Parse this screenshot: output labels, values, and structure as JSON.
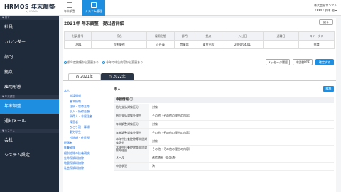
{
  "brand": {
    "name": "HRMOS 年末調整",
    "sub": "by IEYASU"
  },
  "sidebar": {
    "section_basic": "▼ 基本",
    "items_basic": [
      {
        "label": "社員"
      },
      {
        "label": "カレンダー"
      },
      {
        "label": "部門"
      },
      {
        "label": "拠点"
      },
      {
        "label": "雇用形態"
      }
    ],
    "section_year_end": "▼ 年末調整",
    "items_year_end": [
      {
        "label": "年末調整",
        "active": true
      },
      {
        "label": "通知メール"
      }
    ],
    "section_system": "▼ システム",
    "items_system": [
      {
        "label": "会社"
      },
      {
        "label": "システム設定"
      }
    ]
  },
  "topbar": {
    "tabs": [
      {
        "label": "年末調整"
      },
      {
        "label": "システム管理",
        "active": true
      }
    ],
    "company": "株式会社サンプル",
    "user": "XXXXX 鈴木 優 ▾"
  },
  "main": {
    "title": "2021年 年末調整　提出者詳細",
    "return_button": "戻る",
    "employee_table": {
      "headers": [
        "社員番号",
        "氏名",
        "雇用形態",
        "部門",
        "拠点",
        "入社日",
        "退職日",
        "ステータス"
      ],
      "row": [
        "1001",
        "鈴木優也",
        "正社員",
        "営業部",
        "東京支店",
        "2000/04/01",
        "",
        "申請"
      ]
    },
    "notes": [
      "前年度数値から変更あり",
      "今年の申告内容から変更あり"
    ],
    "buttons": {
      "message_history": "メッセージ履歴",
      "declaration_pdf": "申告書PDF",
      "confirm": "確定する"
    },
    "year_tabs": [
      "2021年",
      "2022年"
    ],
    "left_nav": [
      {
        "label": "本人",
        "sub": false
      },
      {
        "label": "申請情報",
        "sub": true
      },
      {
        "label": "基本情報",
        "sub": true
      },
      {
        "label": "住所・世帯主等",
        "sub": true
      },
      {
        "label": "収入・所得金額",
        "sub": true
      },
      {
        "label": "所得人・非居住者",
        "sub": true
      },
      {
        "label": "障害者",
        "sub": true
      },
      {
        "label": "ひとり親・寡婦",
        "sub": true
      },
      {
        "label": "勤労学生",
        "sub": true
      },
      {
        "label": "控除額・住民税",
        "sub": true
      },
      {
        "label": "配偶者",
        "sub": false
      },
      {
        "label": "扶養親族",
        "sub": false
      },
      {
        "label": "個別控除の扶養親族",
        "sub": false
      },
      {
        "label": "生命保険料控除",
        "sub": false
      },
      {
        "label": "地震保険料控除",
        "sub": false
      },
      {
        "label": "社会保険料控除",
        "sub": false
      }
    ],
    "section_title": "本人",
    "edit_button": "編集",
    "application_header": "申請情報 ⓘ",
    "application_rows": [
      {
        "label": "給与支払対象区分",
        "value": "対象"
      },
      {
        "label": "給与支払対象外理由",
        "value": "その他（その他の理由の内容）"
      },
      {
        "label": "年末調整対象区分",
        "value": "対象"
      },
      {
        "label": "年末調整対象外理由",
        "value": "その他（その他の理由の内容）"
      },
      {
        "label": "本年中扶養控除等申告対象区分",
        "value": "対象"
      },
      {
        "label": "本年中扶養控除等申告対象外理由",
        "value": "その他（その他の理由の内容）"
      },
      {
        "label": "メール",
        "value": "送信済み（既読済）"
      },
      {
        "label": "申告状況",
        "value": "済"
      }
    ]
  }
}
